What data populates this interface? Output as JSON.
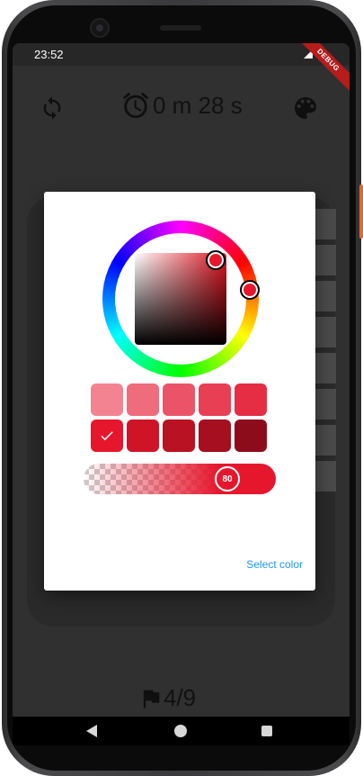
{
  "status_bar": {
    "time": "23:52",
    "debug_banner": "DEBUG"
  },
  "header": {
    "timer_text": "0 m 28 s",
    "restart_icon": "restart-icon",
    "alarm_icon": "alarm-clock-icon",
    "palette_icon": "palette-icon"
  },
  "footer": {
    "flag_icon": "flag-icon",
    "progress_text": "4/9"
  },
  "color_picker": {
    "selected_color": "#e6172d",
    "swatches": [
      {
        "color": "#f48391"
      },
      {
        "color": "#ef6c7c"
      },
      {
        "color": "#eb5468"
      },
      {
        "color": "#e83f55"
      },
      {
        "color": "#e52d44"
      },
      {
        "color": "#e6172d",
        "selected": true
      },
      {
        "color": "#cf1428"
      },
      {
        "color": "#b81223"
      },
      {
        "color": "#a50f1f"
      },
      {
        "color": "#8d0c1b"
      }
    ],
    "alpha_value": "80",
    "select_label": "Select color"
  },
  "theme": {
    "screen_bg": "#303030",
    "accent": "#2196f3",
    "debug_red": "#b71c1c"
  }
}
